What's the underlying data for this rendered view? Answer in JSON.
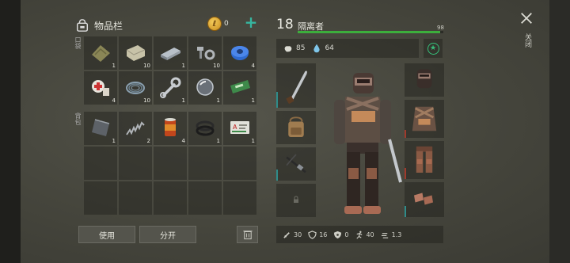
{
  "inventory": {
    "title": "物品栏",
    "coins": "0",
    "pocket_label": "口袋",
    "backpack_label": "背包",
    "pocket_items": [
      {
        "name": "cloth",
        "qty": "1"
      },
      {
        "name": "fabric",
        "qty": "10"
      },
      {
        "name": "iron-bar",
        "qty": "1"
      },
      {
        "name": "bolts",
        "qty": "10"
      },
      {
        "name": "duct-tape",
        "qty": "4"
      },
      {
        "name": "bandage",
        "qty": "4"
      },
      {
        "name": "wire",
        "qty": "10"
      },
      {
        "name": "wrench",
        "qty": "1"
      },
      {
        "name": "glass",
        "qty": "1"
      },
      {
        "name": "cash-coupon",
        "qty": "1"
      }
    ],
    "backpack_items": [
      {
        "name": "metal-plate",
        "qty": "1"
      },
      {
        "name": "spring",
        "qty": "2"
      },
      {
        "name": "fuel-can",
        "qty": "4"
      },
      {
        "name": "rubber-ring",
        "qty": "1"
      },
      {
        "name": "card",
        "qty": "1"
      }
    ],
    "use_button": "使用",
    "split_button": "分开"
  },
  "character": {
    "level": "18",
    "name": "隔离者",
    "hp": "98",
    "hp_fraction": 0.98,
    "food": "85",
    "water": "64",
    "stats": {
      "attack": "30",
      "defense": "16",
      "radiation": "0",
      "speed": "40",
      "weight": "1.3"
    }
  },
  "close_label": "关闭",
  "colors": {
    "accent": "#36b6a0",
    "hp_bar": "#3cae3c",
    "quality_teal": "#2f8c8a",
    "quality_red": "#a03a2c"
  }
}
